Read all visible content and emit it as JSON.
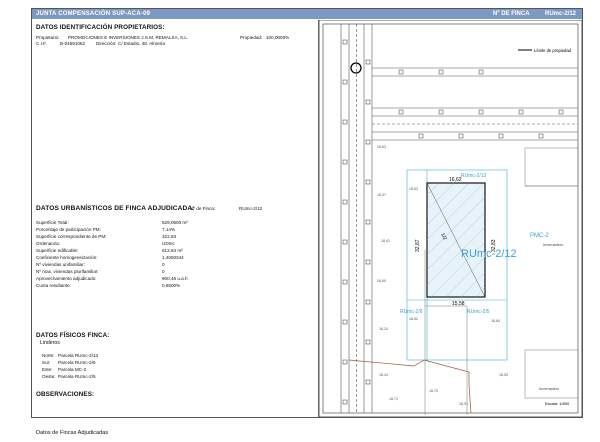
{
  "banner": {
    "title": "JUNTA COMPENSACIÓN SUP-ACA-09",
    "finca_label": "Nº DE FINCA",
    "finca_value": "RUmc-2/12"
  },
  "owners": {
    "heading": "DATOS IDENTIFICACIÓN PROPIETARIOS:",
    "owner_label": "Propietario:",
    "owner_value": "PROMOCIONES E INVERSIONES J.S.M. REMALSA, S.L.",
    "share_label": "Propiedad:",
    "share_value": "100,0000%",
    "cif_label": "C.I.F.",
    "cif_value": "B-04591062",
    "address_label": "Dirección:",
    "address_value": "C/ Estadio, 48. Almería"
  },
  "urban": {
    "heading": "DATOS URBANÍSTICOS DE FINCA ADJUDICADA:",
    "finca_label": "Nº de Finca:",
    "finca_value": "RUmc-2/12",
    "rows": [
      {
        "label": "Superficie Total:",
        "value": "529,0500 m²"
      },
      {
        "label": "Porcentaje de participación PM:",
        "value": "7,14%"
      },
      {
        "label": "Superficie correspondiente de PM:",
        "value": "322,83"
      },
      {
        "label": "Ordenanza:",
        "value": "UDmc"
      },
      {
        "label": "Superficie edificable:",
        "value": "613,84 m²"
      },
      {
        "label": "Coeficiente homogeneización:",
        "value": "1,4650344"
      },
      {
        "label": "Nº viviendas unifamiliar:",
        "value": "0"
      },
      {
        "label": "Nº max. viviendas plurifamiliar:",
        "value": "0"
      },
      {
        "label": "Aprovechamiento adjudicado:",
        "value": "900,46 u.a.h"
      },
      {
        "label": "Cuota resultante:",
        "value": "0,6500%"
      }
    ]
  },
  "physical": {
    "heading": "DATOS FÍSICOS FINCA:",
    "linderos_label": "Linderos",
    "rows": [
      {
        "label": "Norte:",
        "value": "Parcela RUmc-2/13"
      },
      {
        "label": "Sur:",
        "value": "Parcela RUmc-2/6"
      },
      {
        "label": "Este:",
        "value": "Parcela MC-2"
      },
      {
        "label": "Oeste:",
        "value": "Parcela RUmc-2/5"
      }
    ]
  },
  "observaciones": {
    "heading": "OBSERVACIONES:"
  },
  "map": {
    "legend": "Límite de propiedad",
    "parcel_label": "RUmc-2/12",
    "north_label": "RUmc-2/13",
    "south_left_label": "RUmc-2/6",
    "south_right_label": "RUmc-2/5",
    "east_label": "PMC-2",
    "east_note": "Invernadero",
    "se_note": "Invernadero",
    "dim_top": "16,62",
    "dim_left": "32,87",
    "dim_right": "32,83",
    "dim_bottom": "15,58",
    "diag": "1/2",
    "scale": "Escala: 1/500",
    "elevations": [
      "18,63",
      "18,37",
      "18,41",
      "18,60",
      "18,53",
      "18,52",
      "18,64",
      "18,24",
      "18,43",
      "18,71",
      "18,53",
      "18,70",
      "18,91"
    ]
  },
  "footer": "Datos de Fincas Adjudicadas"
}
